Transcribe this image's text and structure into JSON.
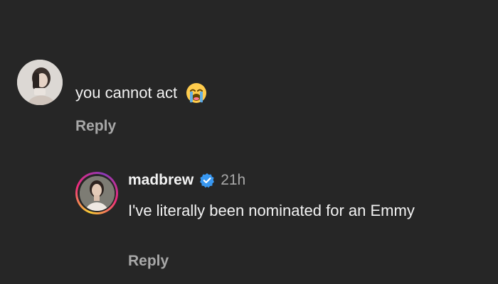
{
  "theme": {
    "background": "#262626",
    "primary_text": "#f2f2f2",
    "secondary_text": "#a8a8a8",
    "verified_color": "#3897f0"
  },
  "comments": [
    {
      "avatar_icon": "user-photo-avatar",
      "text": "you cannot act",
      "emoji_icon": "loudly-crying-face-emoji",
      "reply_label": "Reply"
    },
    {
      "avatar_icon": "user-photo-avatar-story-ring",
      "username": "madbrew",
      "verified_icon": "verified-badge-icon",
      "timestamp": "21h",
      "text": "I've literally been nominated for an Emmy",
      "reply_label": "Reply"
    }
  ]
}
